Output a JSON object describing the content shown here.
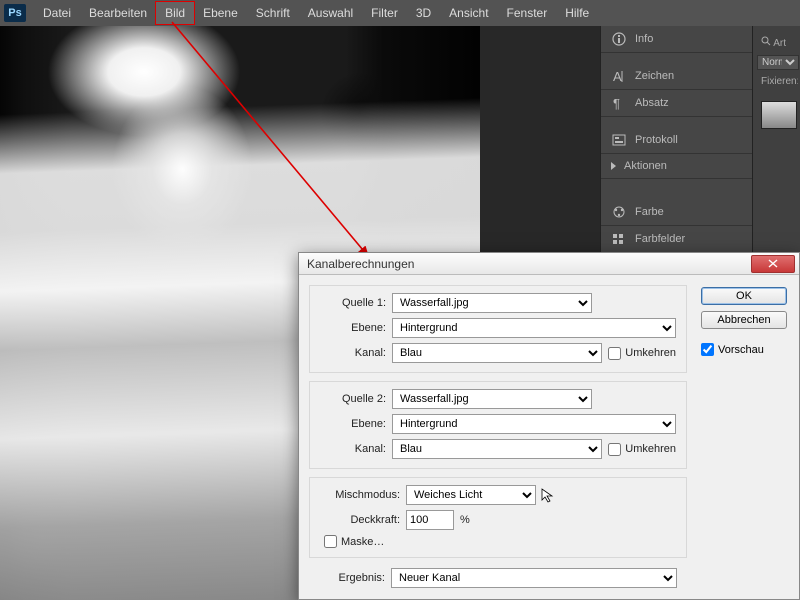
{
  "menubar": {
    "items": [
      "Datei",
      "Bearbeiten",
      "Bild",
      "Ebene",
      "Schrift",
      "Auswahl",
      "Filter",
      "3D",
      "Ansicht",
      "Fenster",
      "Hilfe"
    ],
    "highlighted_index": 2
  },
  "panels": {
    "info": "Info",
    "zeichen": "Zeichen",
    "absatz": "Absatz",
    "protokoll": "Protokoll",
    "aktionen": "Aktionen",
    "farbe": "Farbe",
    "farbfelder": "Farbfelder"
  },
  "far_panel": {
    "art_placeholder": "Art",
    "mode": "Normal",
    "fixieren": "Fixieren:"
  },
  "dialog": {
    "title": "Kanalberechnungen",
    "ok": "OK",
    "cancel": "Abbrechen",
    "preview_label": "Vorschau",
    "preview_checked": true,
    "source1": {
      "label": "Quelle 1:",
      "value": "Wasserfall.jpg",
      "layer_label": "Ebene:",
      "layer_value": "Hintergrund",
      "channel_label": "Kanal:",
      "channel_value": "Blau",
      "invert_label": "Umkehren",
      "invert_checked": false
    },
    "source2": {
      "label": "Quelle 2:",
      "value": "Wasserfall.jpg",
      "layer_label": "Ebene:",
      "layer_value": "Hintergrund",
      "channel_label": "Kanal:",
      "channel_value": "Blau",
      "invert_label": "Umkehren",
      "invert_checked": false
    },
    "blend": {
      "mode_label": "Mischmodus:",
      "mode_value": "Weiches Licht",
      "opacity_label": "Deckkraft:",
      "opacity_value": "100",
      "opacity_suffix": "%",
      "mask_label": "Maske…",
      "mask_checked": false
    },
    "result": {
      "label": "Ergebnis:",
      "value": "Neuer Kanal"
    }
  }
}
